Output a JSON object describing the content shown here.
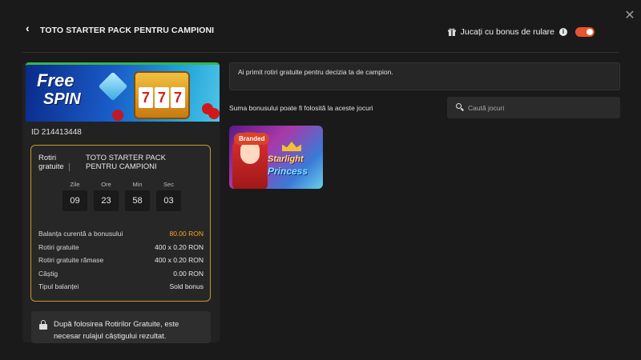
{
  "header": {
    "title": "TOTO STARTER PACK PENTRU CAMPIONI",
    "bonus_toggle_label": "Jucați cu bonus de rulare",
    "toggle_on": true
  },
  "banner": {
    "text_line1": "Free",
    "text_line2": "SPIN",
    "reel_symbols": [
      "7",
      "7",
      "7"
    ]
  },
  "bonus": {
    "id_text": "ID 214413448",
    "type_label": "Rotiri gratuite",
    "name": "TOTO STARTER PACK PENTRU CAMPIONI",
    "timer": [
      {
        "label": "Zile",
        "value": "09"
      },
      {
        "label": "Ore",
        "value": "23"
      },
      {
        "label": "Min",
        "value": "58"
      },
      {
        "label": "Sec",
        "value": "03"
      }
    ],
    "rows": [
      {
        "label": "Balanța curentă a bonusului",
        "value": "80.00 RON",
        "highlight": true
      },
      {
        "label": "Rotiri gratuite",
        "value": "400 x 0.20 RON"
      },
      {
        "label": "Rotiri gratuite rămase",
        "value": "400 x 0.20 RON"
      },
      {
        "label": "Câștig",
        "value": "0.00 RON"
      },
      {
        "label": "Tipul balanței",
        "value": "Sold bonus"
      }
    ],
    "notice": "După folosirea Rotirilor Gratuite, este necesar rulajul câștigului rezultat."
  },
  "main": {
    "message": "Ai primit rotiri gratuite pentru decizia ta de campion.",
    "games_label": "Suma bonusului poate fi folosită la aceste jocuri",
    "search_placeholder": "Caută jocuri",
    "games": [
      {
        "badge": "Branded",
        "logo_line1": "Starlight",
        "logo_line2": "Princess"
      }
    ]
  },
  "colors": {
    "accent": "#e8542c",
    "card_border": "#c9962b",
    "balance_highlight": "#f5a623",
    "banner_top": "#39b54a"
  }
}
